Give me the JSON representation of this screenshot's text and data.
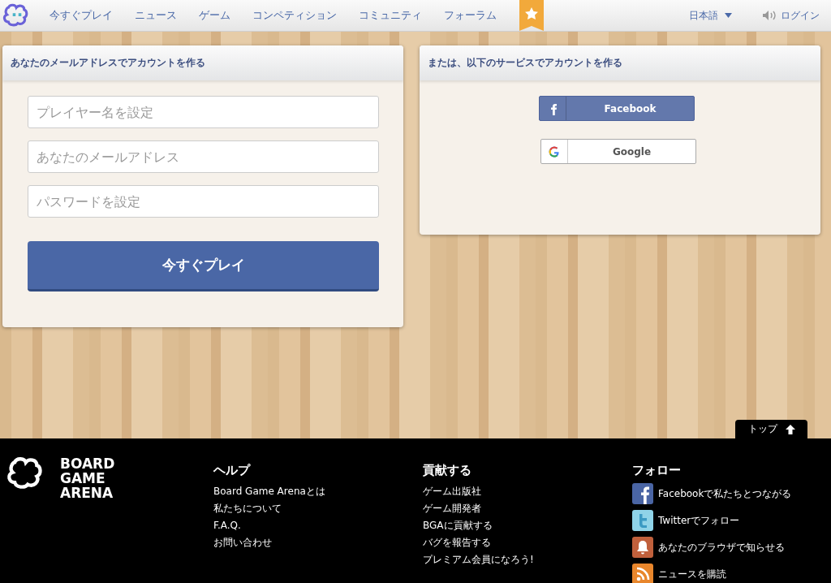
{
  "header": {
    "nav": [
      {
        "label": "今すぐプレイ"
      },
      {
        "label": "ニュース"
      },
      {
        "label": "ゲーム"
      },
      {
        "label": "コンペティション"
      },
      {
        "label": "コミュニティ"
      },
      {
        "label": "フォーラム"
      }
    ],
    "language": "日本語",
    "login": "ログイン"
  },
  "email_panel": {
    "title": "あなたのメールアドレスでアカウントを作る",
    "fields": [
      {
        "placeholder": "プレイヤー名を設定"
      },
      {
        "placeholder": "あなたのメールアドレス"
      },
      {
        "placeholder": "パスワードを設定"
      }
    ],
    "submit": "今すぐプレイ"
  },
  "social_panel": {
    "title": "または、以下のサービスでアカウントを作る",
    "buttons": [
      {
        "kind": "facebook",
        "label": "Facebook"
      },
      {
        "kind": "google",
        "label": "Google"
      }
    ]
  },
  "back_to_top": "トップ",
  "footer": {
    "logo_lines": [
      "BOARD",
      "GAME",
      "ARENA"
    ],
    "columns": [
      {
        "heading": "ヘルプ",
        "links": [
          "Board Game Arenaとは",
          "私たちについて",
          "F.A.Q.",
          "お問い合わせ"
        ]
      },
      {
        "heading": "貢献する",
        "links": [
          "ゲーム出版社",
          "ゲーム開発者",
          "BGAに貢献する",
          "バグを報告する",
          "プレミアム会員になろう!"
        ]
      }
    ],
    "follow": {
      "heading": "フォロー",
      "links": [
        {
          "kind": "facebook",
          "label": "Facebookで私たちとつながる"
        },
        {
          "kind": "twitter",
          "label": "Twitterでフォロー"
        },
        {
          "kind": "bell",
          "label": "あなたのブラウザで知らせる"
        },
        {
          "kind": "rss",
          "label": "ニュースを購読"
        }
      ]
    }
  }
}
